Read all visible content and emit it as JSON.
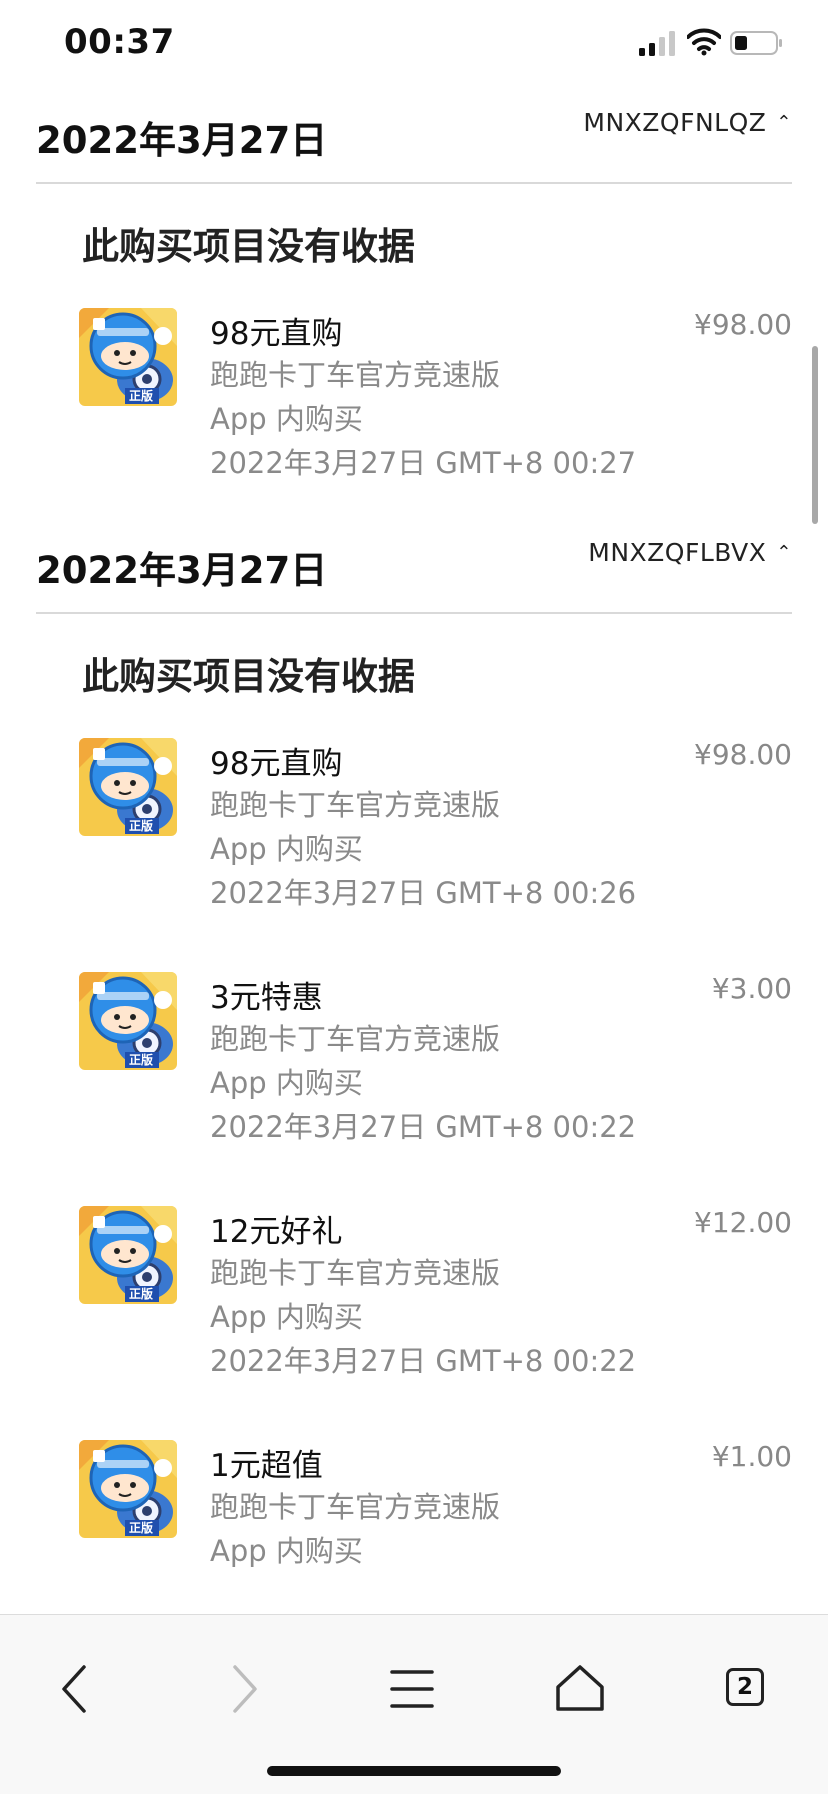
{
  "status_bar": {
    "time": "00:37"
  },
  "sections": [
    {
      "date": "2022年3月27日",
      "order_id": "MNXZQFNLQZ",
      "no_receipt": "此购买项目没有收据",
      "items": [
        {
          "title": "98元直购",
          "price": "¥98.00",
          "app": "跑跑卡丁车官方竞速版",
          "type": "App 内购买",
          "datetime": "2022年3月27日 GMT+8 00:27"
        }
      ]
    },
    {
      "date": "2022年3月27日",
      "order_id": "MNXZQFLBVX",
      "no_receipt": "此购买项目没有收据",
      "items": [
        {
          "title": "98元直购",
          "price": "¥98.00",
          "app": "跑跑卡丁车官方竞速版",
          "type": "App 内购买",
          "datetime": "2022年3月27日 GMT+8 00:26"
        },
        {
          "title": "3元特惠",
          "price": "¥3.00",
          "app": "跑跑卡丁车官方竞速版",
          "type": "App 内购买",
          "datetime": "2022年3月27日 GMT+8 00:22"
        },
        {
          "title": "12元好礼",
          "price": "¥12.00",
          "app": "跑跑卡丁车官方竞速版",
          "type": "App 内购买",
          "datetime": "2022年3月27日 GMT+8 00:22"
        },
        {
          "title": "1元超值",
          "price": "¥1.00",
          "app": "跑跑卡丁车官方竞速版",
          "type": "App 内购买",
          "datetime": ""
        }
      ]
    }
  ],
  "app_icon": {
    "badge": "正版"
  },
  "toolbar": {
    "tabs_count": "2"
  }
}
